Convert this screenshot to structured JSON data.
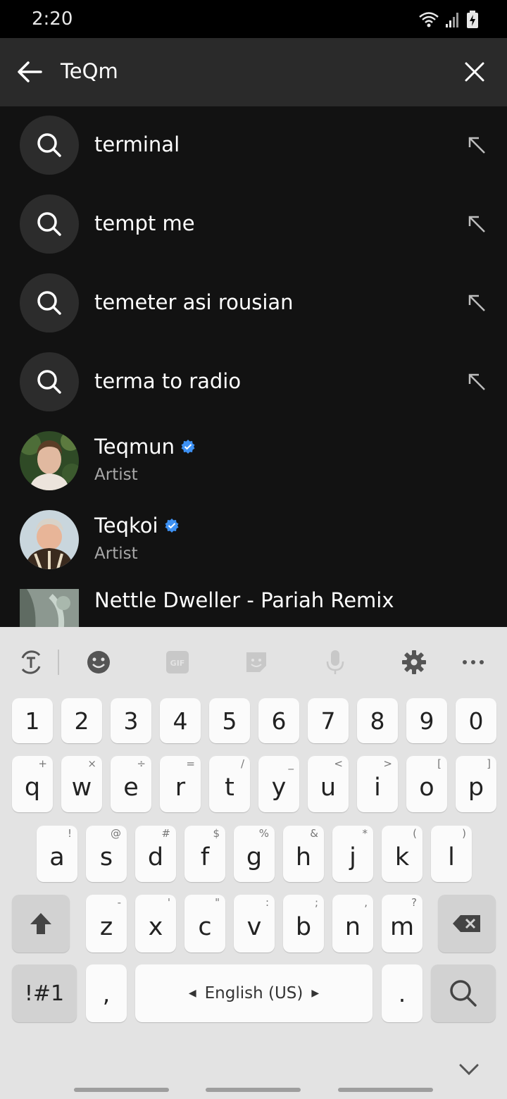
{
  "status_bar": {
    "time": "2:20"
  },
  "search": {
    "query": "TeQm"
  },
  "suggestions": [
    {
      "text": "terminal"
    },
    {
      "text": "tempt me"
    },
    {
      "text": "temeter asi rousian"
    },
    {
      "text": "terma to radio"
    }
  ],
  "artists": [
    {
      "name": "Teqmun",
      "type": "Artist"
    },
    {
      "name": "Teqkoi",
      "type": "Artist"
    }
  ],
  "tracks": [
    {
      "title": "Nettle Dweller - Pariah Remix"
    }
  ],
  "keyboard": {
    "number_row": [
      "1",
      "2",
      "3",
      "4",
      "5",
      "6",
      "7",
      "8",
      "9",
      "0"
    ],
    "row1": [
      {
        "k": "q",
        "h": "+"
      },
      {
        "k": "w",
        "h": "×"
      },
      {
        "k": "e",
        "h": "÷"
      },
      {
        "k": "r",
        "h": "="
      },
      {
        "k": "t",
        "h": "/"
      },
      {
        "k": "y",
        "h": "_"
      },
      {
        "k": "u",
        "h": "<"
      },
      {
        "k": "i",
        "h": ">"
      },
      {
        "k": "o",
        "h": "["
      },
      {
        "k": "p",
        "h": "]"
      }
    ],
    "row2": [
      {
        "k": "a",
        "h": "!"
      },
      {
        "k": "s",
        "h": "@"
      },
      {
        "k": "d",
        "h": "#"
      },
      {
        "k": "f",
        "h": "$"
      },
      {
        "k": "g",
        "h": "%"
      },
      {
        "k": "h",
        "h": "&"
      },
      {
        "k": "j",
        "h": "*"
      },
      {
        "k": "k",
        "h": "("
      },
      {
        "k": "l",
        "h": ")"
      }
    ],
    "row3": [
      {
        "k": "z",
        "h": "-"
      },
      {
        "k": "x",
        "h": "'"
      },
      {
        "k": "c",
        "h": "\""
      },
      {
        "k": "v",
        "h": ":"
      },
      {
        "k": "b",
        "h": ";"
      },
      {
        "k": "n",
        "h": ","
      },
      {
        "k": "m",
        "h": "?"
      }
    ],
    "symbols_label": "!#1",
    "comma_label": ",",
    "space_label": "English (US)",
    "period_label": "."
  },
  "colors": {
    "background": "#121212",
    "header": "#2a2a2a",
    "verified": "#3d91f4",
    "keyboard_bg": "#e3e3e3"
  }
}
